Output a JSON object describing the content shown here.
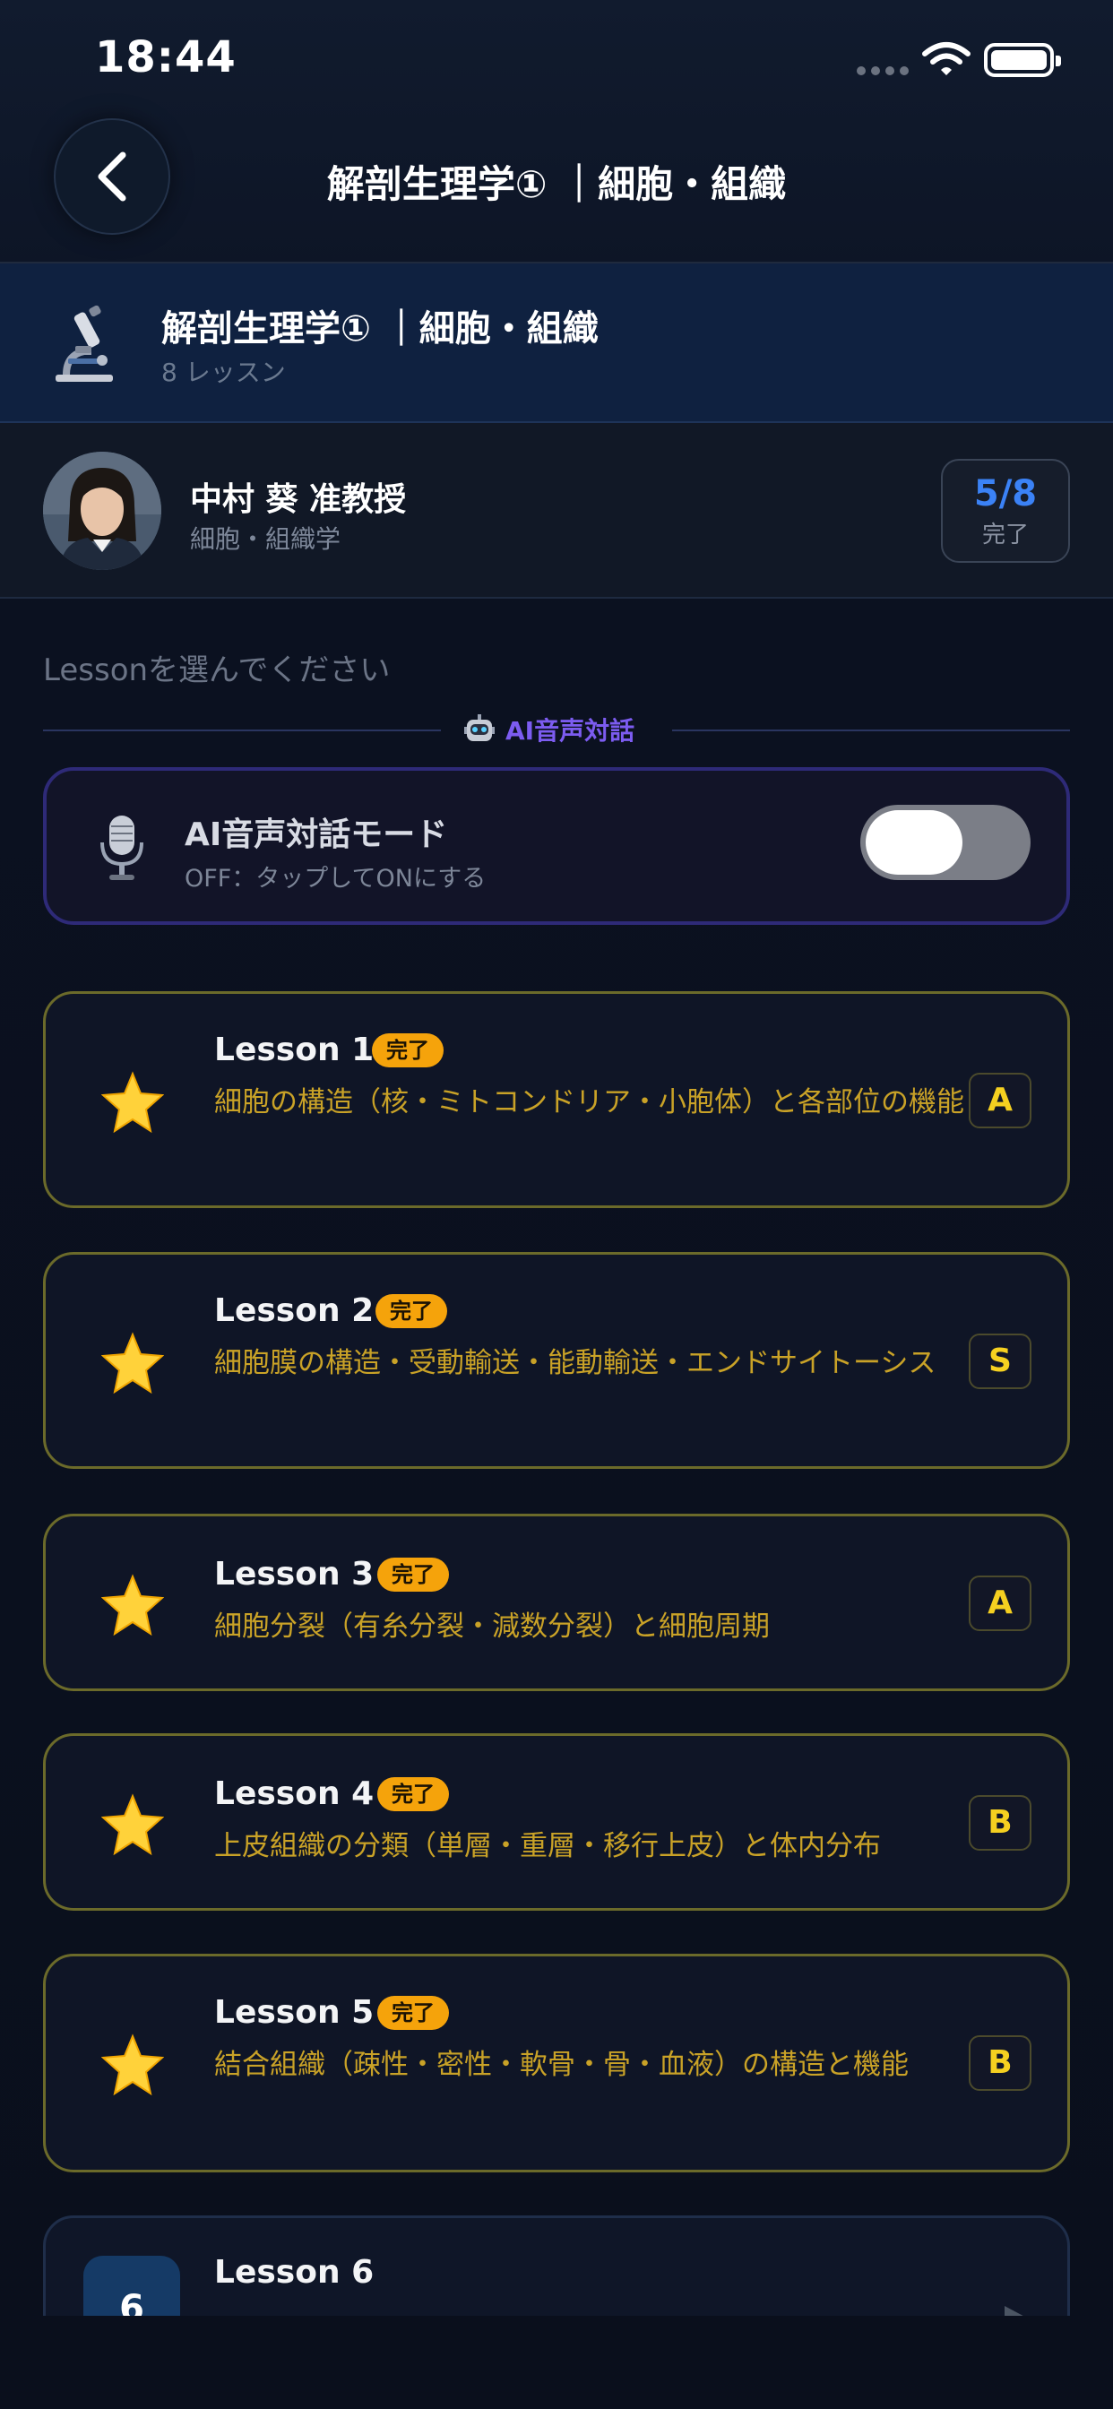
{
  "status_bar": {
    "time": "18:44"
  },
  "header": {
    "title": "解剖生理学① ｜細胞・組織"
  },
  "course": {
    "title": "解剖生理学① ｜細胞・組織",
    "lesson_count": "8 レッスン"
  },
  "instructor": {
    "name": "中村 葵 准教授",
    "field": "細胞・組織学",
    "progress": "5/8",
    "progress_label": "完了"
  },
  "prompt": "Lessonを選んでください",
  "ai_section": {
    "label": "AI音声対話",
    "mode_title": "AI音声対話モード",
    "mode_subtitle": "OFF：タップしてONにする",
    "toggle_on": false
  },
  "lessons": [
    {
      "title": "Lesson 1",
      "badge": "完了",
      "desc": "細胞の構造（核・ミトコンドリア・小胞体）と各部位の機能",
      "grade": "A"
    },
    {
      "title": "Lesson 2",
      "badge": "完了",
      "desc": "細胞膜の構造・受動輸送・能動輸送・エンドサイトーシス",
      "grade": "S"
    },
    {
      "title": "Lesson 3",
      "badge": "完了",
      "desc": "細胞分裂（有糸分裂・減数分裂）と細胞周期",
      "grade": "A"
    },
    {
      "title": "Lesson 4",
      "badge": "完了",
      "desc": "上皮組織の分類（単層・重層・移行上皮）と体内分布",
      "grade": "B"
    },
    {
      "title": "Lesson 5",
      "badge": "完了",
      "desc": "結合組織（疎性・密性・軟骨・骨・血液）の構造と機能",
      "grade": "B"
    },
    {
      "title": "Lesson 6",
      "number": "6"
    }
  ],
  "colors": {
    "accent_blue": "#3b82f6",
    "accent_purple": "#7c5cf0",
    "badge_orange": "#f5a30b",
    "lesson_text_gold": "#c9a227",
    "grade_yellow": "#f5d020"
  },
  "icons": {
    "back": "chevron-left-icon",
    "course": "microscope-icon",
    "ai_section": "robot-icon",
    "ai_mode": "microphone-icon",
    "lesson_done": "star-icon",
    "lesson_play": "play-icon"
  }
}
